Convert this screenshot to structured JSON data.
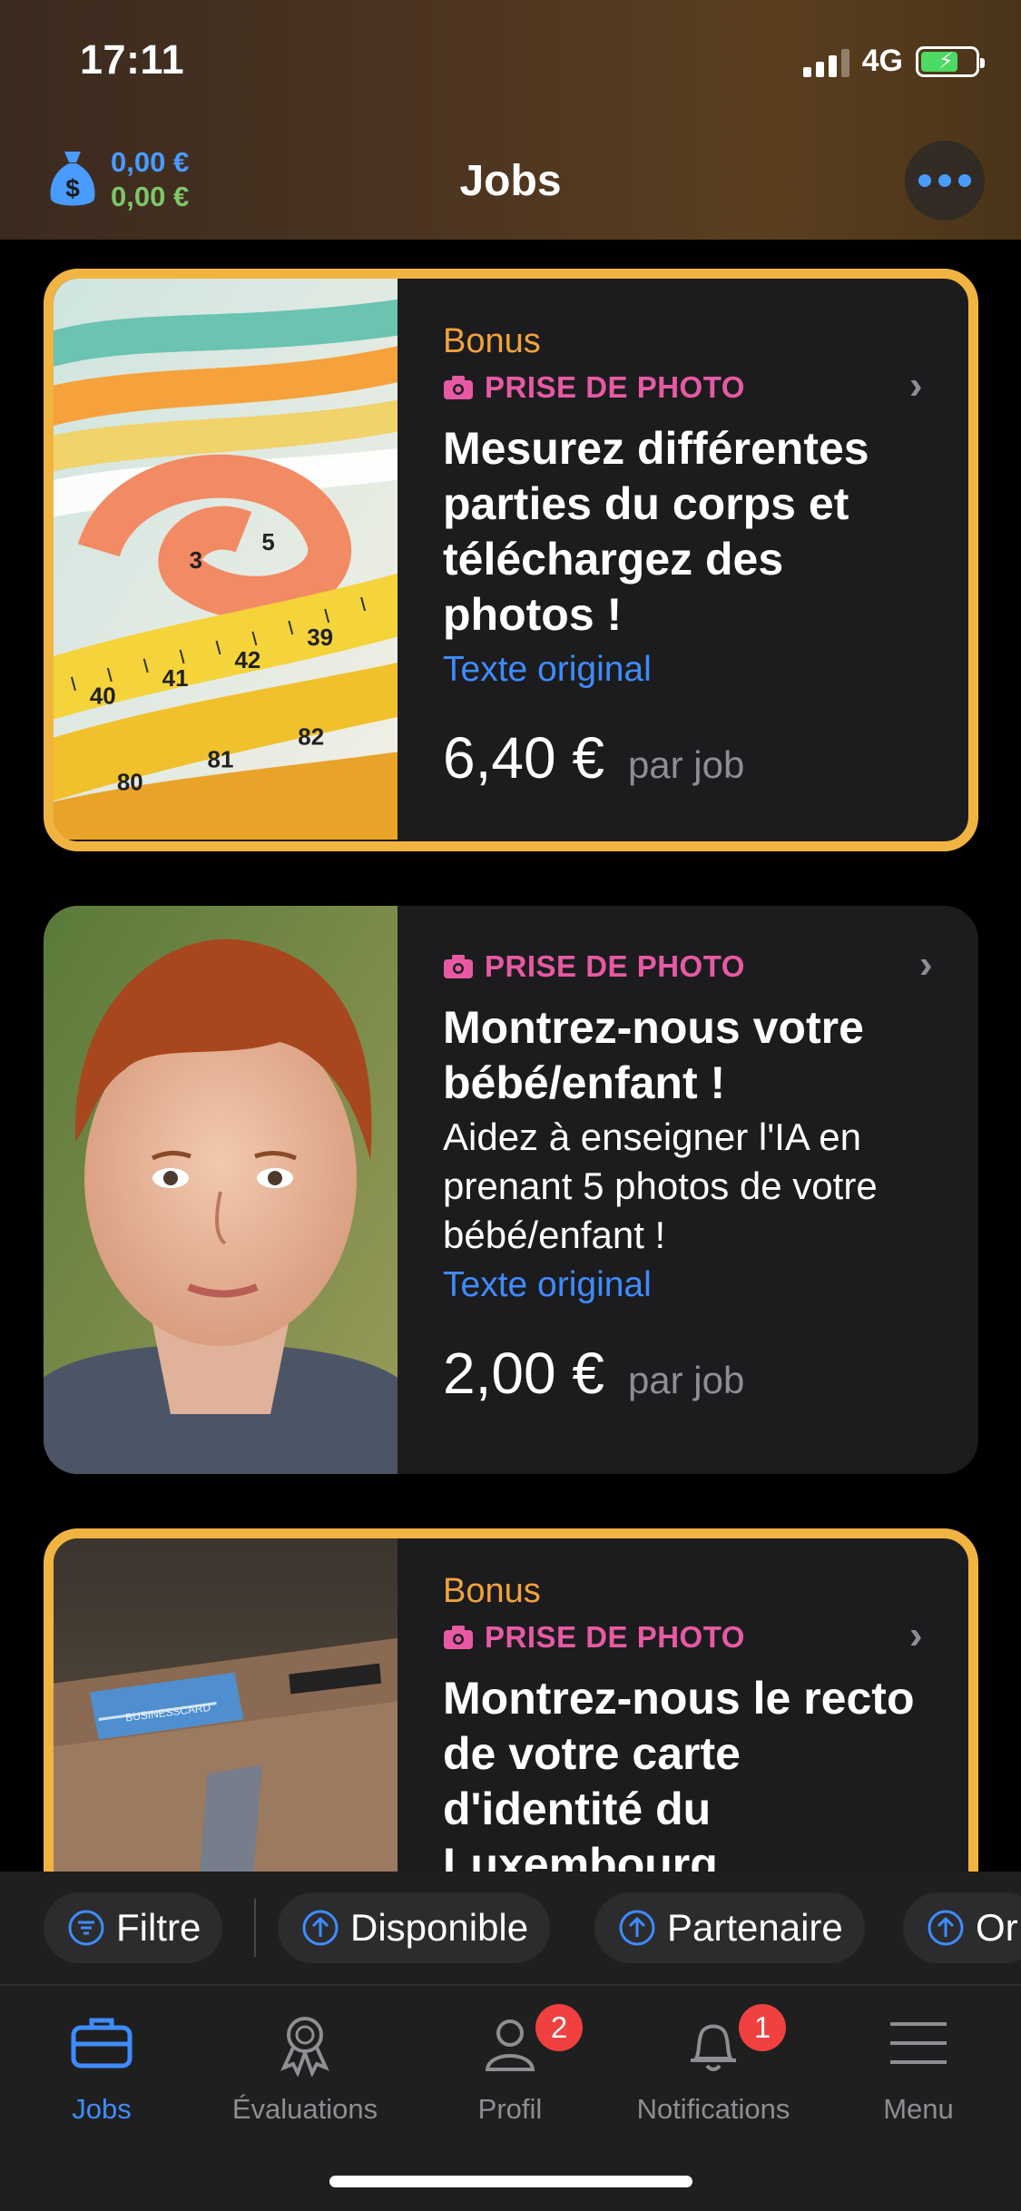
{
  "status": {
    "time": "17:11",
    "network": "4G"
  },
  "header": {
    "title": "Jobs",
    "balance_primary": "0,00 €",
    "balance_secondary": "0,00 €",
    "wallet_icon": "money-bag-icon",
    "more_icon": "ellipsis-icon"
  },
  "cards": [
    {
      "bonus": "Bonus",
      "category": "PRISE DE PHOTO",
      "title": "Mesurez différentes parties du corps et téléchargez des photos !",
      "description": "",
      "original_link": "Texte original",
      "price": "6,40 €",
      "per": "par job",
      "image": "measuring-tape-photo"
    },
    {
      "bonus": "",
      "category": "PRISE DE PHOTO",
      "title": "Montrez-nous votre bébé/enfant !",
      "description": "Aidez à enseigner l'IA en prenant 5 photos de votre bébé/enfant !",
      "original_link": "Texte original",
      "price": "2,00 €",
      "per": "par job",
      "image": "child-portrait-photo"
    },
    {
      "bonus": "Bonus",
      "category": "PRISE DE PHOTO",
      "title": "Montrez-nous le recto de votre carte d'identité du Luxembourg",
      "image": "wallet-card-photo"
    }
  ],
  "filters": [
    {
      "label": "Filtre",
      "icon": "filter-icon"
    },
    {
      "label": "Disponible",
      "icon": "arrow-up-circle-icon"
    },
    {
      "label": "Partenaire",
      "icon": "arrow-up-circle-icon"
    },
    {
      "label": "Or",
      "icon": "arrow-up-circle-icon"
    }
  ],
  "tabs": [
    {
      "label": "Jobs",
      "icon": "briefcase-icon",
      "active": true
    },
    {
      "label": "Évaluations",
      "icon": "award-icon",
      "active": false
    },
    {
      "label": "Profil",
      "icon": "person-icon",
      "badge": "2"
    },
    {
      "label": "Notifications",
      "icon": "bell-icon",
      "badge": "1"
    },
    {
      "label": "Menu",
      "icon": "hamburger-icon"
    }
  ],
  "colors": {
    "accent_blue": "#3f8cff",
    "bonus_border": "#f2b441",
    "bonus_text": "#f2a23a",
    "category_pink": "#e75aa3",
    "badge_red": "#f04040"
  }
}
